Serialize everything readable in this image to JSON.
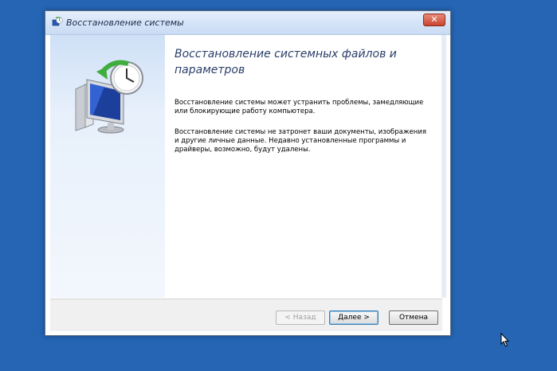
{
  "window": {
    "title": "Восстановление системы",
    "close_label": "✕"
  },
  "content": {
    "heading": "Восстановление системных файлов и параметров",
    "paragraph1": "Восстановление системы может устранить проблемы, замедляющие или блокирующие работу компьютера.",
    "paragraph2": "Восстановление системы не затронет ваши документы, изображения и другие личные данные. Недавно установленные программы и драйверы, возможно, будут удалены."
  },
  "footer": {
    "back_label": "< Назад",
    "next_label": "Далее >",
    "cancel_label": "Отмена"
  },
  "icons": {
    "title_icon": "system-restore-icon",
    "illustration": "system-restore-illustration",
    "cursor": "mouse-cursor"
  },
  "colors": {
    "desktop": "#2565b4",
    "close_button": "#c94330",
    "heading_text": "#2a3e69"
  }
}
